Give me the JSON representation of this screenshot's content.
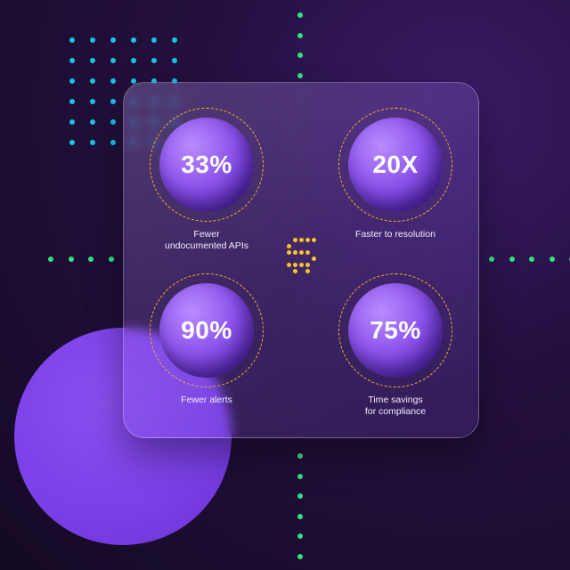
{
  "stats": [
    {
      "value": "33%",
      "label_line1": "Fewer",
      "label_line2": "undocumented APIs"
    },
    {
      "value": "20X",
      "label_line1": "Faster to resolution",
      "label_line2": ""
    },
    {
      "value": "90%",
      "label_line1": "Fewer alerts",
      "label_line2": ""
    },
    {
      "value": "75%",
      "label_line1": "Time savings",
      "label_line2": "for compliance"
    }
  ],
  "colors": {
    "accent_purple": "#7a3fe6",
    "dot_cyan": "#17c3e6",
    "dot_green": "#35e07e",
    "ring_gold": "#f0b429"
  }
}
